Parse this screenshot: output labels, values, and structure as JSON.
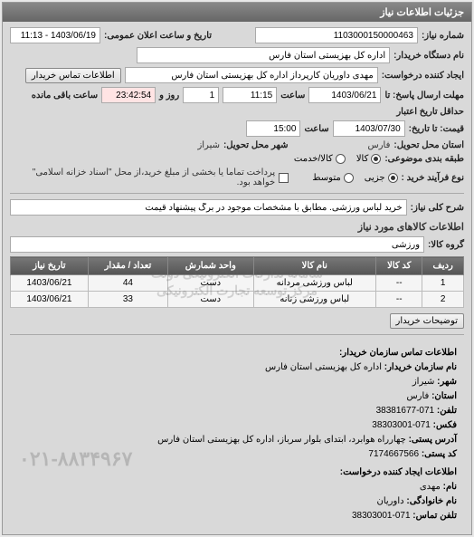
{
  "header": {
    "title": "جزئیات اطلاعات نیاز"
  },
  "fields": {
    "request_number_label": "شماره نیاز:",
    "request_number": "1103000150000463",
    "public_datetime_label": "تاریخ و ساعت اعلان عمومی:",
    "public_datetime": "1403/06/19 - 11:13",
    "buyer_org_label": "نام دستگاه خریدار:",
    "buyer_org": "اداره کل بهزیستی استان فارس",
    "buyer_contact_btn": "اطلاعات تماس خریدار",
    "creator_label": "ایجاد کننده درخواست:",
    "creator": "مهدی داوریان کارپرداز اداره کل بهزیستی استان فارس",
    "response_deadline_label": "مهلت ارسال پاسخ: تا",
    "response_date": "1403/06/21",
    "time_label": "ساعت",
    "response_time": "11:15",
    "remain_days": "1",
    "day_label": "روز و",
    "remain_time": "23:42:54",
    "remain_suffix": "ساعت باقی مانده",
    "price_until_label": "قیمت: تا تاریخ:",
    "price_date": "1403/07/30",
    "price_time": "15:00",
    "least_validity_label": "حداقل تاریخ اعتبار",
    "delivery_province_label": "استان محل تحویل:",
    "delivery_province": "فارس",
    "delivery_city_label": "شهر محل تحویل:",
    "delivery_city": "شیراز",
    "supply_category_label": "طبقه بندی موضوعی:",
    "supply_all": "کالا",
    "supply_service": "کالا/خدمت",
    "purchase_type_label": "نوع فرآیند خرید :",
    "pt_small": "جزیی",
    "pt_medium": "متوسط",
    "payment_note_label": "پرداخت تماما یا بخشی از مبلغ خرید،از محل \"اسناد خزانه اسلامی\" خواهد بود.",
    "general_desc_label": "شرح کلی نیاز:",
    "general_desc": "خرید لباس ورزشی. مطابق با مشخصات موجود در برگ پیشنهاد قیمت",
    "goods_info_title": "اطلاعات کالاهای مورد نیاز",
    "goods_group_label": "گروه کالا:",
    "goods_group": "ورزشی",
    "explain_btn": "توضیحات خریدار"
  },
  "table": {
    "headers": {
      "row": "ردیف",
      "code": "کد کالا",
      "name": "نام کالا",
      "unit": "واحد شمارش",
      "qty": "تعداد / مقدار",
      "date": "تاریخ نیاز"
    },
    "rows": [
      {
        "row": "1",
        "code": "--",
        "name": "لباس ورزشی مردانه",
        "unit": "دست",
        "qty": "44",
        "date": "1403/06/21"
      },
      {
        "row": "2",
        "code": "--",
        "name": "لباس ورزشی زنانه",
        "unit": "دست",
        "qty": "33",
        "date": "1403/06/21"
      }
    ]
  },
  "contact": {
    "title": "اطلاعات تماس سازمان خریدار:",
    "org_label": "نام سازمان خریدار:",
    "org": "اداره کل بهزیستی استان فارس",
    "city_label": "شهر:",
    "city": "شیراز",
    "province_label": "استان:",
    "province": "فارس",
    "phone_label": "تلفن:",
    "phone": "071-38381677",
    "fax_label": "فکس:",
    "fax": "071-38303001",
    "address_label": "آدرس پستی:",
    "address": "چهارراه هوابرد، ابتدای بلوار سرباز، اداره کل بهزیستی استان فارس",
    "postal_label": "کد پستی:",
    "postal": "7174667566",
    "creator_title": "اطلاعات ایجاد کننده درخواست:",
    "name_label": "نام:",
    "name": "مهدی",
    "family_label": "نام خانوادگی:",
    "family": "داوریان",
    "contact_phone_label": "تلفن تماس:",
    "contact_phone": "071-38303001"
  },
  "watermark": {
    "line1": "سامانه تدارکات الکترونیکی دولت",
    "line2": "مرکز توسعه تجارت الکترونیکی",
    "phone": "۰۲۱-۸۸۳۴۹۶۷"
  }
}
